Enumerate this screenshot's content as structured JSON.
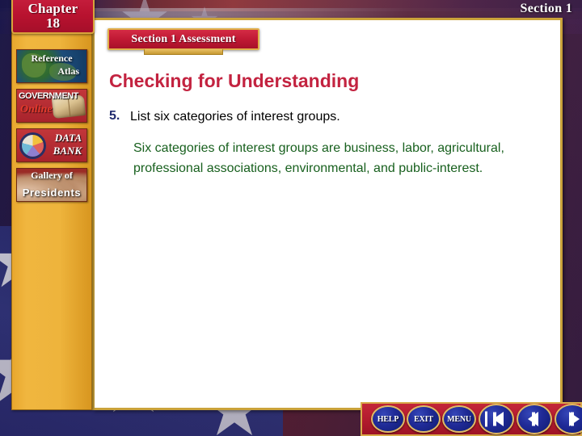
{
  "chapter": {
    "label": "Chapter",
    "number": "18"
  },
  "section_label": "Section 1",
  "banner": {
    "title": "Section 1 Assessment"
  },
  "content": {
    "heading": "Checking for Understanding",
    "question_number": "5.",
    "question": "List six categories of interest groups.",
    "answer": "Six categories of interest groups are business, labor, agricultural, professional associations, environmental, and public-interest."
  },
  "sidebar": {
    "items": [
      {
        "id": "reference-atlas",
        "line1": "Reference",
        "line2": "Atlas"
      },
      {
        "id": "government-online",
        "line1": "GOVERNMENT",
        "line2": "Online"
      },
      {
        "id": "data-bank",
        "line1": "DATA",
        "line2": "BANK"
      },
      {
        "id": "gallery-of-presidents",
        "line1": "Gallery of",
        "line2": "Presidents"
      }
    ]
  },
  "nav": {
    "buttons": [
      {
        "id": "help",
        "label": "HELP"
      },
      {
        "id": "exit",
        "label": "EXIT"
      },
      {
        "id": "menu",
        "label": "MENU"
      }
    ],
    "arrows": [
      {
        "id": "first-slide",
        "icon": "first-arrow-icon"
      },
      {
        "id": "previous-slide",
        "icon": "back-arrow-icon"
      },
      {
        "id": "next-slide",
        "icon": "forward-arrow-icon"
      }
    ]
  },
  "colors": {
    "heading_red": "#c32340",
    "answer_green": "#18601e",
    "number_blue": "#1f2a6e",
    "gold": "#eeb43c",
    "banner_red": "#c01934"
  }
}
